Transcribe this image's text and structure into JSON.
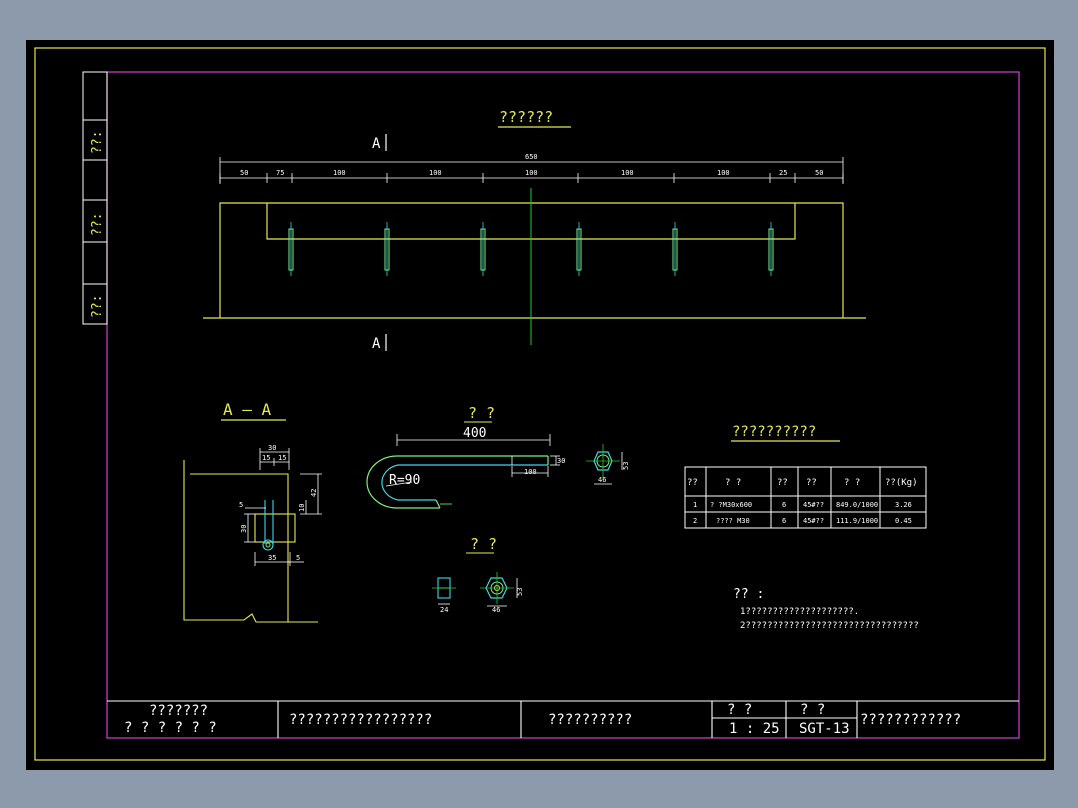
{
  "colors": {
    "background": "#8d9aab",
    "sheet": "#000000",
    "border_yellow": "#e7e756",
    "frame_magenta": "#d040d0",
    "text_white": "#ffffff",
    "centerline_green": "#28c828",
    "cyan": "#3ad8e8",
    "bright_green": "#7cf07c"
  },
  "side_stamp": [
    "??:",
    "??:",
    "??:"
  ],
  "elevation": {
    "title": "??????",
    "section_marker": "A",
    "overall_dim": "650",
    "dims": [
      "50",
      "75",
      "100",
      "100",
      "100",
      "100",
      "100",
      "25",
      "50"
    ]
  },
  "section": {
    "title": "A — A",
    "dims": {
      "top_width": "30",
      "top_halves": [
        "15",
        "15"
      ],
      "right_height": "42",
      "small_right": "10",
      "left_offset": "5",
      "left_height": "30",
      "bottom_width": "35",
      "bottom_right": "5"
    }
  },
  "bolt": {
    "title": "? ?",
    "length": "400",
    "radius": "R=90",
    "thread_len": "100",
    "end_dim": "30",
    "head_dim": "46",
    "head_height": "53"
  },
  "nut": {
    "title": "? ?",
    "width": "24",
    "across_flats": "46",
    "height": "53"
  },
  "table": {
    "title": "??????????",
    "headers": [
      "??",
      "? ?",
      "??",
      "??",
      "? ?",
      "??(Kg)"
    ],
    "rows": [
      [
        "1",
        "? ?M30x600",
        "6",
        "45#??",
        "849.0/1000",
        "3.26"
      ],
      [
        "2",
        "???? M30",
        "6",
        "45#??",
        "111.9/1000",
        "0.45"
      ]
    ]
  },
  "notes": {
    "heading": "?? :",
    "lines": [
      "1????????????????????.",
      "2????????????????????????????????"
    ]
  },
  "title_block": {
    "org_line1": "???????",
    "org_line2": "? ? ? ? ? ?",
    "project": "?????????????????",
    "drawing_name": "??????????",
    "scale_label": "? ?",
    "scale": "1 : 25",
    "number_label": "? ?",
    "number": "SGT-13",
    "extra": "????????????"
  }
}
